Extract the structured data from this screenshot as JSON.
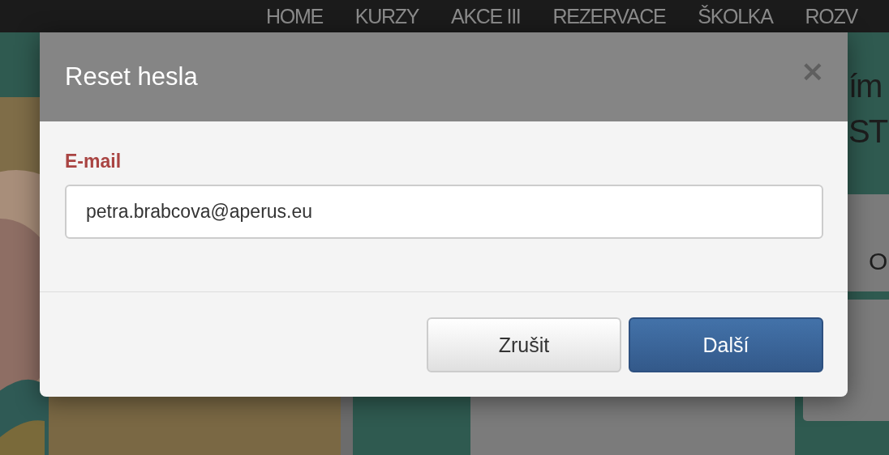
{
  "nav": {
    "items": [
      {
        "label": "HOME"
      },
      {
        "label": "KURZY"
      },
      {
        "label": "AKCE III"
      },
      {
        "label": "REZERVACE"
      },
      {
        "label": "ŠKOLKA"
      },
      {
        "label": "ROZV"
      }
    ]
  },
  "background": {
    "heading_lines": [
      "ím",
      "ST"
    ],
    "tile_text": "O"
  },
  "dialog": {
    "title": "Reset hesla",
    "close": "×",
    "field_label": "E-mail",
    "email_value": "petra.brabcova@aperus.eu",
    "buttons": [
      {
        "label": "Zrušit",
        "kind": "secondary"
      },
      {
        "label": "Další",
        "kind": "primary"
      }
    ]
  }
}
